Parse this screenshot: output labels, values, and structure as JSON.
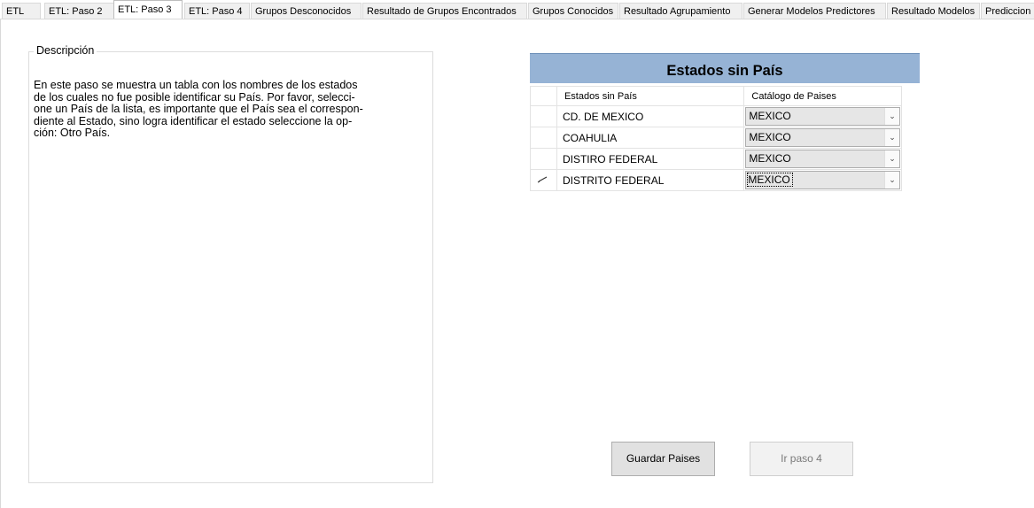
{
  "tabs": [
    {
      "label": "ETL",
      "active": false
    },
    {
      "label": "ETL: Paso 2",
      "active": false
    },
    {
      "label": "ETL: Paso 3",
      "active": true
    },
    {
      "label": "ETL: Paso 4",
      "active": false
    },
    {
      "label": "Grupos Desconocidos",
      "active": false
    },
    {
      "label": "Resultado de Grupos Encontrados",
      "active": false
    },
    {
      "label": "Grupos Conocidos",
      "active": false
    },
    {
      "label": "Resultado Agrupamiento",
      "active": false
    },
    {
      "label": "Generar Modelos Predictores",
      "active": false
    },
    {
      "label": "Resultado Modelos",
      "active": false
    },
    {
      "label": "Prediccion",
      "active": false
    }
  ],
  "description": {
    "title": "Descripción",
    "lines": [
      "En este paso se muestra un tabla con los nombres de los estados",
      "de los cuales no fue posible identificar su País. Por favor, selecci-",
      "one un País de la lista, es importante que el País sea el correspon-",
      "diente al Estado, sino logra identificar el estado seleccione la op-",
      "ción: Otro País."
    ]
  },
  "grid": {
    "title": "Estados sin País",
    "columns": [
      "Estados sin País",
      "Catálogo de Paises"
    ],
    "rows": [
      {
        "estado": "CD. DE MEXICO",
        "pais": "MEXICO",
        "editing": false
      },
      {
        "estado": "COAHULIA",
        "pais": "MEXICO",
        "editing": false
      },
      {
        "estado": "DISTIRO FEDERAL",
        "pais": "MEXICO",
        "editing": false
      },
      {
        "estado": "DISTRITO FEDERAL",
        "pais": "MEXICO",
        "editing": true
      }
    ]
  },
  "buttons": {
    "save": "Guardar Paises",
    "next": "Ir paso 4"
  }
}
